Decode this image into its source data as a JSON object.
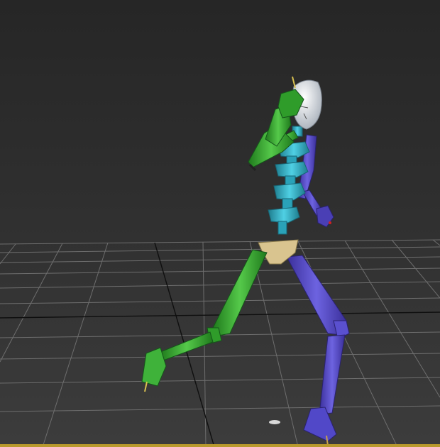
{
  "viewport": {
    "background_top": "#262626",
    "background_bottom": "#3c3c3c",
    "frame_color": "#b99a2d"
  },
  "grid": {
    "line_color": "#6e6e6e",
    "axis_color": "#0f0f0f"
  },
  "biped": {
    "left_side_color": "#2f9c2a",
    "left_side_highlight": "#55c94a",
    "right_side_color": "#4a3fb5",
    "right_side_highlight": "#6d63e0",
    "spine_color": "#2aa2b8",
    "spine_highlight": "#4fd0e4",
    "head_color": "#d8dde3",
    "pelvis_color": "#d9c48f"
  }
}
